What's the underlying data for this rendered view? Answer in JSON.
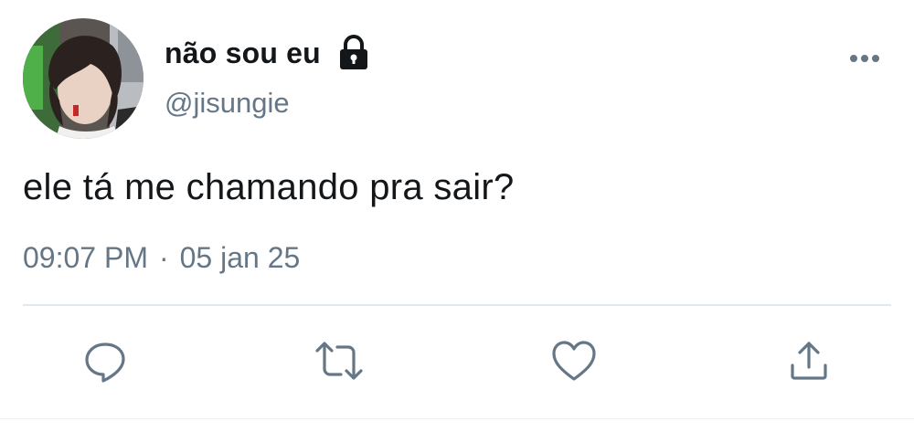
{
  "author": {
    "display_name": "não sou eu",
    "handle": "@jisungie",
    "protected": true
  },
  "tweet": {
    "text": "ele tá me chamando pra sair?",
    "time": "09:07 PM",
    "separator": "·",
    "date": "05 jan 25"
  },
  "icons": {
    "lock": "lock-icon",
    "more": "more-horizontal-icon",
    "reply": "reply-icon",
    "retweet": "retweet-icon",
    "like": "heart-icon",
    "share": "share-icon"
  },
  "colors": {
    "text_primary": "#14171a",
    "text_secondary": "#657786",
    "icon": "#657786",
    "divider": "#e1e8ed"
  }
}
